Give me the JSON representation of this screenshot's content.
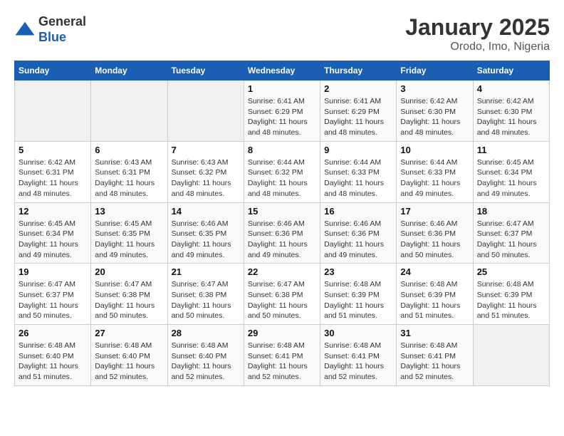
{
  "header": {
    "logo_line1": "General",
    "logo_line2": "Blue",
    "title": "January 2025",
    "subtitle": "Orodo, Imo, Nigeria"
  },
  "weekdays": [
    "Sunday",
    "Monday",
    "Tuesday",
    "Wednesday",
    "Thursday",
    "Friday",
    "Saturday"
  ],
  "weeks": [
    [
      {
        "day": "",
        "empty": true
      },
      {
        "day": "",
        "empty": true
      },
      {
        "day": "",
        "empty": true
      },
      {
        "day": "1",
        "sunrise": "6:41 AM",
        "sunset": "6:29 PM",
        "daylight": "11 hours and 48 minutes."
      },
      {
        "day": "2",
        "sunrise": "6:41 AM",
        "sunset": "6:29 PM",
        "daylight": "11 hours and 48 minutes."
      },
      {
        "day": "3",
        "sunrise": "6:42 AM",
        "sunset": "6:30 PM",
        "daylight": "11 hours and 48 minutes."
      },
      {
        "day": "4",
        "sunrise": "6:42 AM",
        "sunset": "6:30 PM",
        "daylight": "11 hours and 48 minutes."
      }
    ],
    [
      {
        "day": "5",
        "sunrise": "6:42 AM",
        "sunset": "6:31 PM",
        "daylight": "11 hours and 48 minutes."
      },
      {
        "day": "6",
        "sunrise": "6:43 AM",
        "sunset": "6:31 PM",
        "daylight": "11 hours and 48 minutes."
      },
      {
        "day": "7",
        "sunrise": "6:43 AM",
        "sunset": "6:32 PM",
        "daylight": "11 hours and 48 minutes."
      },
      {
        "day": "8",
        "sunrise": "6:44 AM",
        "sunset": "6:32 PM",
        "daylight": "11 hours and 48 minutes."
      },
      {
        "day": "9",
        "sunrise": "6:44 AM",
        "sunset": "6:33 PM",
        "daylight": "11 hours and 48 minutes."
      },
      {
        "day": "10",
        "sunrise": "6:44 AM",
        "sunset": "6:33 PM",
        "daylight": "11 hours and 49 minutes."
      },
      {
        "day": "11",
        "sunrise": "6:45 AM",
        "sunset": "6:34 PM",
        "daylight": "11 hours and 49 minutes."
      }
    ],
    [
      {
        "day": "12",
        "sunrise": "6:45 AM",
        "sunset": "6:34 PM",
        "daylight": "11 hours and 49 minutes."
      },
      {
        "day": "13",
        "sunrise": "6:45 AM",
        "sunset": "6:35 PM",
        "daylight": "11 hours and 49 minutes."
      },
      {
        "day": "14",
        "sunrise": "6:46 AM",
        "sunset": "6:35 PM",
        "daylight": "11 hours and 49 minutes."
      },
      {
        "day": "15",
        "sunrise": "6:46 AM",
        "sunset": "6:36 PM",
        "daylight": "11 hours and 49 minutes."
      },
      {
        "day": "16",
        "sunrise": "6:46 AM",
        "sunset": "6:36 PM",
        "daylight": "11 hours and 49 minutes."
      },
      {
        "day": "17",
        "sunrise": "6:46 AM",
        "sunset": "6:36 PM",
        "daylight": "11 hours and 50 minutes."
      },
      {
        "day": "18",
        "sunrise": "6:47 AM",
        "sunset": "6:37 PM",
        "daylight": "11 hours and 50 minutes."
      }
    ],
    [
      {
        "day": "19",
        "sunrise": "6:47 AM",
        "sunset": "6:37 PM",
        "daylight": "11 hours and 50 minutes."
      },
      {
        "day": "20",
        "sunrise": "6:47 AM",
        "sunset": "6:38 PM",
        "daylight": "11 hours and 50 minutes."
      },
      {
        "day": "21",
        "sunrise": "6:47 AM",
        "sunset": "6:38 PM",
        "daylight": "11 hours and 50 minutes."
      },
      {
        "day": "22",
        "sunrise": "6:47 AM",
        "sunset": "6:38 PM",
        "daylight": "11 hours and 50 minutes."
      },
      {
        "day": "23",
        "sunrise": "6:48 AM",
        "sunset": "6:39 PM",
        "daylight": "11 hours and 51 minutes."
      },
      {
        "day": "24",
        "sunrise": "6:48 AM",
        "sunset": "6:39 PM",
        "daylight": "11 hours and 51 minutes."
      },
      {
        "day": "25",
        "sunrise": "6:48 AM",
        "sunset": "6:39 PM",
        "daylight": "11 hours and 51 minutes."
      }
    ],
    [
      {
        "day": "26",
        "sunrise": "6:48 AM",
        "sunset": "6:40 PM",
        "daylight": "11 hours and 51 minutes."
      },
      {
        "day": "27",
        "sunrise": "6:48 AM",
        "sunset": "6:40 PM",
        "daylight": "11 hours and 52 minutes."
      },
      {
        "day": "28",
        "sunrise": "6:48 AM",
        "sunset": "6:40 PM",
        "daylight": "11 hours and 52 minutes."
      },
      {
        "day": "29",
        "sunrise": "6:48 AM",
        "sunset": "6:41 PM",
        "daylight": "11 hours and 52 minutes."
      },
      {
        "day": "30",
        "sunrise": "6:48 AM",
        "sunset": "6:41 PM",
        "daylight": "11 hours and 52 minutes."
      },
      {
        "day": "31",
        "sunrise": "6:48 AM",
        "sunset": "6:41 PM",
        "daylight": "11 hours and 52 minutes."
      },
      {
        "day": "",
        "empty": true
      }
    ]
  ],
  "labels": {
    "sunrise_prefix": "Sunrise: ",
    "sunset_prefix": "Sunset: ",
    "daylight_prefix": "Daylight: "
  }
}
